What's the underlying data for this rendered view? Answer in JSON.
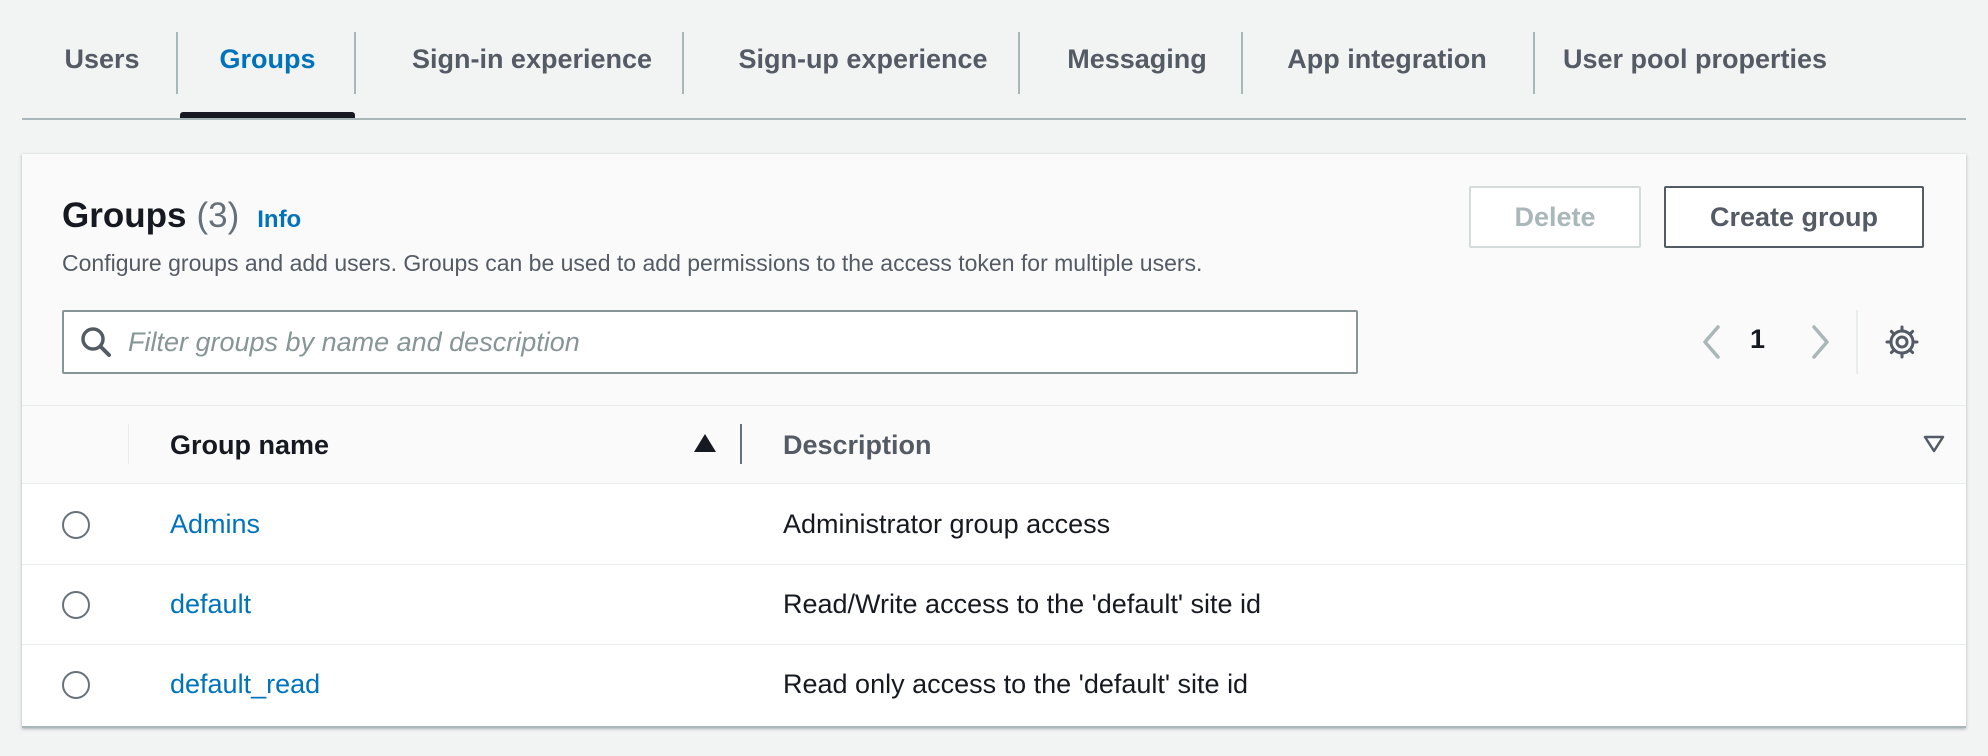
{
  "tabs": [
    {
      "label": "Users"
    },
    {
      "label": "Groups"
    },
    {
      "label": "Sign-in experience"
    },
    {
      "label": "Sign-up experience"
    },
    {
      "label": "Messaging"
    },
    {
      "label": "App integration"
    },
    {
      "label": "User pool properties"
    }
  ],
  "active_tab": "Groups",
  "panel": {
    "title": "Groups",
    "count": "(3)",
    "info_label": "Info",
    "description": "Configure groups and add users. Groups can be used to add permissions to the access token for multiple users.",
    "delete_label": "Delete",
    "create_label": "Create group",
    "search_placeholder": "Filter groups by name and description",
    "page_number": "1"
  },
  "table": {
    "columns": {
      "name": "Group name",
      "description": "Description"
    },
    "rows": [
      {
        "name": "Admins",
        "description": "Administrator group access"
      },
      {
        "name": "default",
        "description": "Read/Write access to the 'default' site id"
      },
      {
        "name": "default_read",
        "description": "Read only access to the 'default' site id"
      }
    ]
  },
  "icons": {
    "search": "search-icon",
    "prev": "chevron-left-icon",
    "next": "chevron-right-icon",
    "settings": "gear-icon",
    "sort_asc": "sort-ascending-icon",
    "sort_desc": "sort-descending-icon"
  },
  "colors": {
    "accent": "#0073bb",
    "active_tab_underline": "#16191f",
    "page_bg": "#f2f3f3",
    "border": "#aab7b8"
  }
}
